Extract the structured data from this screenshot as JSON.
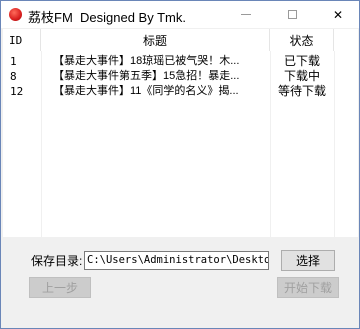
{
  "window": {
    "title": "荔枝FM  Designed By Tmk."
  },
  "list": {
    "columns": {
      "id": "ID",
      "title": "标题",
      "status": "状态"
    },
    "rows": [
      {
        "id": "1",
        "title": "【暴走大事件】18琼瑶已被气哭！木...",
        "status": "已下载"
      },
      {
        "id": "8",
        "title": "【暴走大事件第五季】15急招！暴走...",
        "status": "下载中"
      },
      {
        "id": "12",
        "title": "【暴走大事件】11《同学的名义》揭...",
        "status": "等待下载"
      }
    ]
  },
  "save": {
    "label": "保存目录:",
    "path": "C:\\Users\\Administrator\\Desktop\\",
    "choose_label": "选择"
  },
  "buttons": {
    "prev_label": "上一步",
    "start_label": "开始下载"
  },
  "icons": {
    "app": "lychee-icon",
    "minimize": "minimize-icon",
    "maximize": "maximize-icon",
    "close": "close-icon"
  },
  "colors": {
    "accent": "#d81e1e"
  }
}
